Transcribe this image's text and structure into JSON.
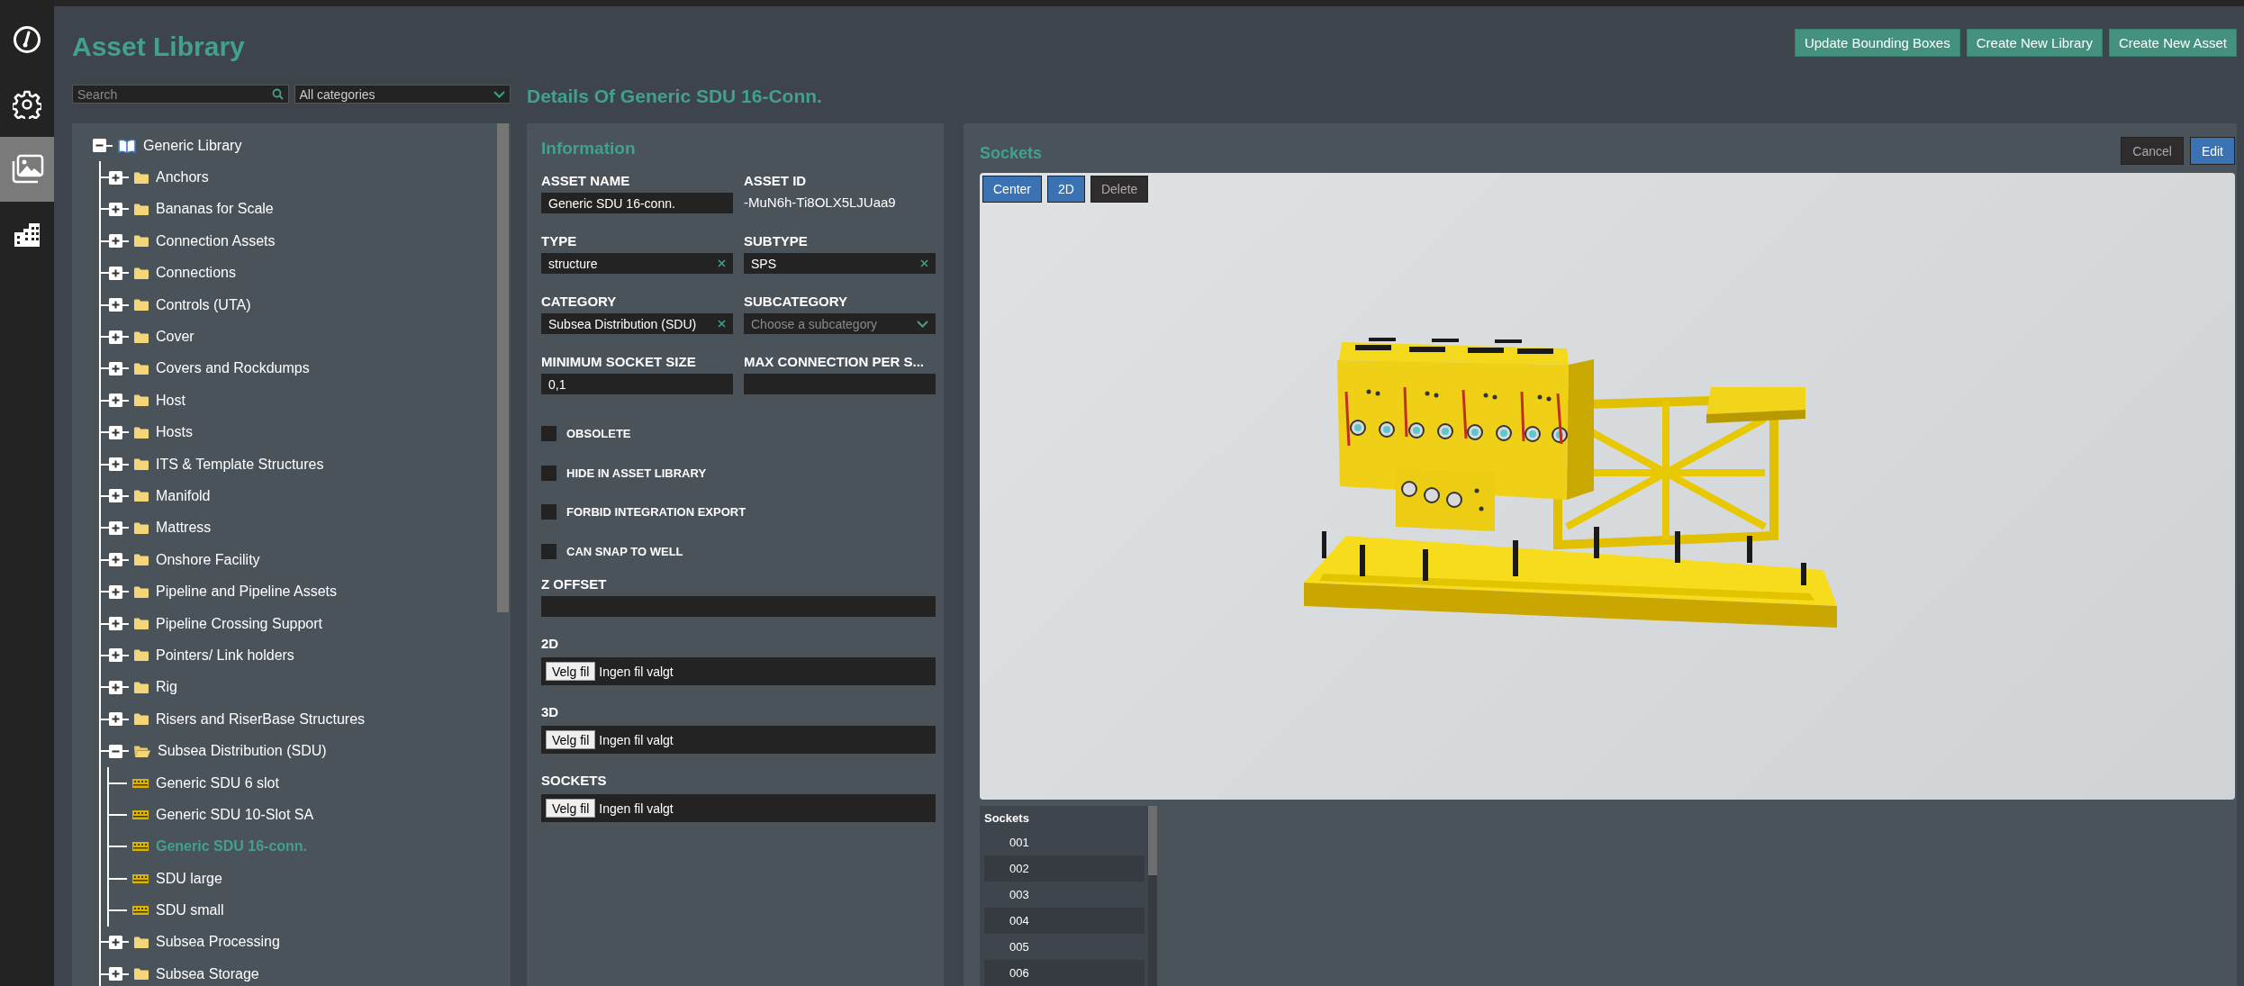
{
  "nav": [
    {
      "kind": "dashboard",
      "selected": false
    },
    {
      "kind": "settings",
      "selected": false
    },
    {
      "kind": "gallery",
      "selected": true
    },
    {
      "kind": "buildings",
      "selected": false
    }
  ],
  "title": "Asset Library",
  "actions": [
    "Update Bounding Boxes",
    "Create New Library",
    "Create New Asset"
  ],
  "search": {
    "placeholder": "Search"
  },
  "category_filter": {
    "value": "All categories"
  },
  "details_title": "Details Of Generic SDU 16-Conn.",
  "tree": {
    "label": "Generic Library",
    "kind": "library",
    "expanded": true,
    "selected": false,
    "children": [
      {
        "label": "Anchors",
        "kind": "folder",
        "expanded": false,
        "selected": false
      },
      {
        "label": "Bananas for Scale",
        "kind": "folder",
        "expanded": false,
        "selected": false
      },
      {
        "label": "Connection Assets",
        "kind": "folder",
        "expanded": false,
        "selected": false
      },
      {
        "label": "Connections",
        "kind": "folder",
        "expanded": false,
        "selected": false
      },
      {
        "label": "Controls (UTA)",
        "kind": "folder",
        "expanded": false,
        "selected": false
      },
      {
        "label": "Cover",
        "kind": "folder",
        "expanded": false,
        "selected": false
      },
      {
        "label": "Covers and Rockdumps",
        "kind": "folder",
        "expanded": false,
        "selected": false
      },
      {
        "label": "Host",
        "kind": "folder",
        "expanded": false,
        "selected": false
      },
      {
        "label": "Hosts",
        "kind": "folder",
        "expanded": false,
        "selected": false
      },
      {
        "label": "ITS & Template Structures",
        "kind": "folder",
        "expanded": false,
        "selected": false
      },
      {
        "label": "Manifold",
        "kind": "folder",
        "expanded": false,
        "selected": false
      },
      {
        "label": "Mattress",
        "kind": "folder",
        "expanded": false,
        "selected": false
      },
      {
        "label": "Onshore Facility",
        "kind": "folder",
        "expanded": false,
        "selected": false
      },
      {
        "label": "Pipeline and Pipeline Assets",
        "kind": "folder",
        "expanded": false,
        "selected": false
      },
      {
        "label": "Pipeline Crossing Support",
        "kind": "folder",
        "expanded": false,
        "selected": false
      },
      {
        "label": "Pointers/ Link holders",
        "kind": "folder",
        "expanded": false,
        "selected": false
      },
      {
        "label": "Rig",
        "kind": "folder",
        "expanded": false,
        "selected": false
      },
      {
        "label": "Risers and RiserBase Structures",
        "kind": "folder",
        "expanded": false,
        "selected": false
      },
      {
        "label": "Subsea Distribution (SDU)",
        "kind": "folder",
        "expanded": true,
        "selected": false,
        "children": [
          {
            "label": "Generic SDU 6 slot",
            "kind": "asset",
            "selected": false
          },
          {
            "label": "Generic SDU 10-Slot SA",
            "kind": "asset",
            "selected": false
          },
          {
            "label": "Generic SDU 16-conn.",
            "kind": "asset",
            "selected": true
          },
          {
            "label": "SDU large",
            "kind": "asset",
            "selected": false
          },
          {
            "label": "SDU small",
            "kind": "asset",
            "selected": false
          }
        ]
      },
      {
        "label": "Subsea Processing",
        "kind": "folder",
        "expanded": false,
        "selected": false
      },
      {
        "label": "Subsea Storage",
        "kind": "folder",
        "expanded": false,
        "selected": false
      }
    ]
  },
  "information": {
    "title": "Information",
    "fields": [
      {
        "label": "ASSET NAME",
        "kind": "input",
        "value": "Generic SDU 16-conn."
      },
      {
        "label": "ASSET ID",
        "kind": "readonly",
        "value": "-MuN6h-Ti8OLX5LJUaa9"
      },
      {
        "label": "TYPE",
        "kind": "clearable",
        "value": "structure"
      },
      {
        "label": "SUBTYPE",
        "kind": "clearable",
        "value": "SPS"
      },
      {
        "label": "CATEGORY",
        "kind": "clearable",
        "value": "Subsea Distribution (SDU)"
      },
      {
        "label": "SUBCATEGORY",
        "kind": "dropdown",
        "placeholder": "Choose a subcategory"
      },
      {
        "label": "MINIMUM SOCKET SIZE",
        "kind": "input",
        "value": "0,1"
      },
      {
        "label": "MAX CONNECTION PER S...",
        "kind": "input"
      }
    ],
    "flags": [
      {
        "label": "OBSOLETE",
        "checked": false
      },
      {
        "label": "HIDE IN ASSET LIBRARY",
        "checked": false
      },
      {
        "label": "FORBID INTEGRATION EXPORT",
        "checked": false
      },
      {
        "label": "CAN SNAP TO WELL",
        "checked": false
      }
    ],
    "z_offset": {
      "label": "Z OFFSET"
    },
    "files": [
      {
        "label": "2D",
        "button": "Velg fil",
        "status": "Ingen fil valgt"
      },
      {
        "label": "3D",
        "button": "Velg fil",
        "status": "Ingen fil valgt"
      },
      {
        "label": "SOCKETS",
        "button": "Velg fil",
        "status": "Ingen fil valgt"
      }
    ]
  },
  "sockets": {
    "title": "Sockets",
    "buttons": [
      {
        "label": "Cancel",
        "kind": "secondary"
      },
      {
        "label": "Edit",
        "kind": "primary"
      }
    ],
    "viewer_tools": [
      {
        "label": "Center",
        "kind": "primary"
      },
      {
        "label": "2D",
        "kind": "primary"
      },
      {
        "label": "Delete",
        "kind": "secondary"
      }
    ],
    "list": {
      "title": "Sockets",
      "items": [
        "001",
        "002",
        "003",
        "004",
        "005",
        "006"
      ]
    }
  }
}
